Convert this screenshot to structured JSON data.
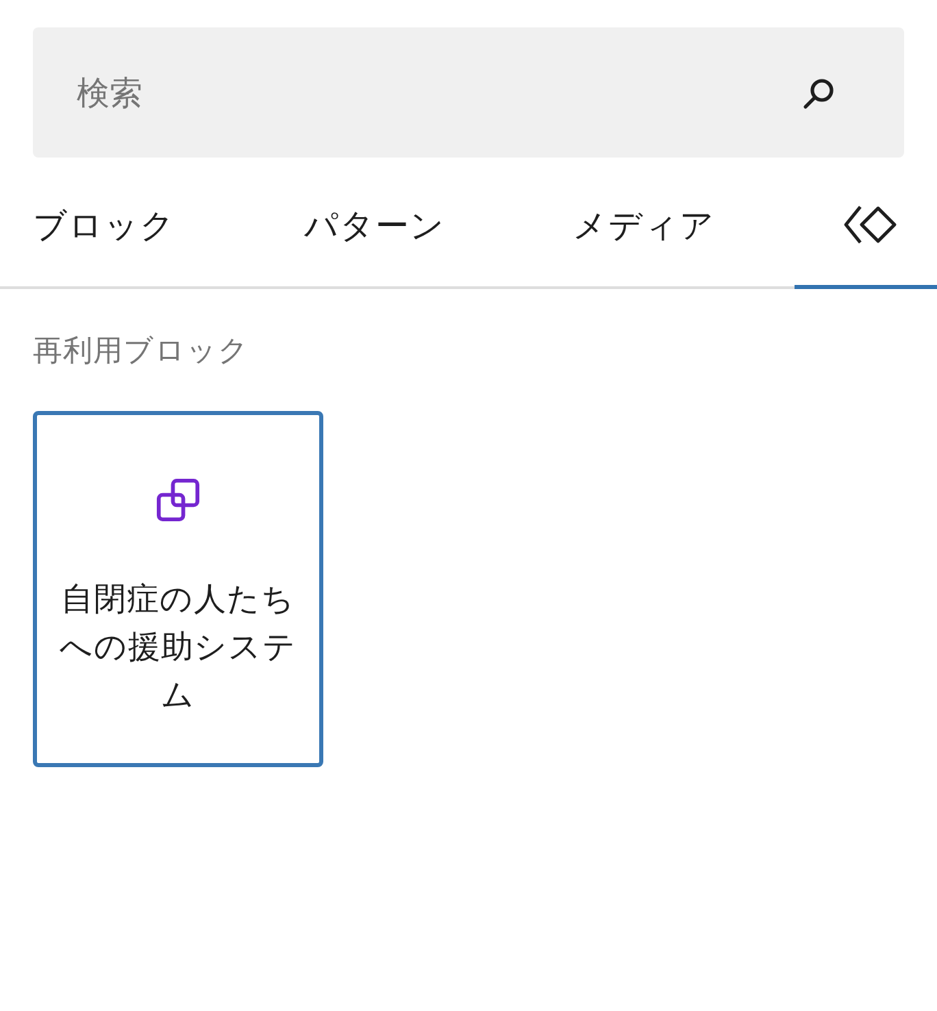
{
  "search": {
    "placeholder": "検索"
  },
  "tabs": [
    {
      "kind": "text",
      "label": "ブロック",
      "selected": false
    },
    {
      "kind": "text",
      "label": "パターン",
      "selected": false
    },
    {
      "kind": "text",
      "label": "メディア",
      "selected": false
    },
    {
      "kind": "icon",
      "selected": true
    }
  ],
  "section": {
    "heading": "再利用ブロック",
    "blocks": [
      {
        "title": "自閉症の人たちへの援助システム",
        "selected": true
      }
    ]
  }
}
